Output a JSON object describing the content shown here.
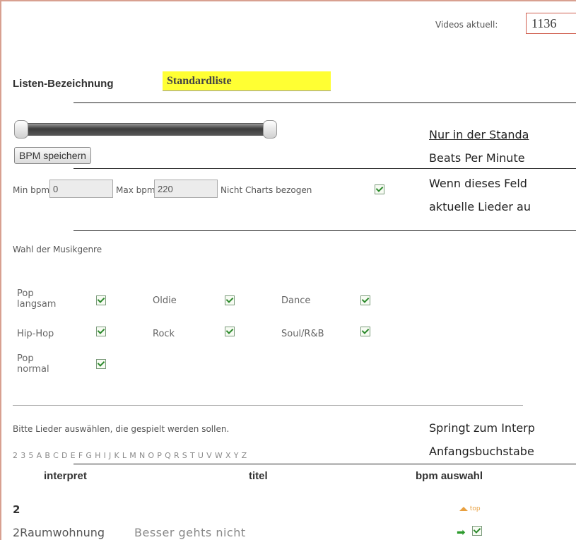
{
  "header": {
    "videos_label": "Videos aktuell:",
    "videos_count": "1136"
  },
  "list": {
    "label": "Listen-Bezeichnung",
    "value": "Standardliste"
  },
  "bpm": {
    "save_button": "BPM speichern",
    "note_line1": "Nur in der Standa",
    "note_line2": "Beats Per Minute",
    "min_label": "Min bpm:",
    "min_value": "0",
    "max_label": "Max bpm:",
    "max_value": "220",
    "charts_label": "Nicht Charts bezogen",
    "charts_note_line1": "Wenn dieses Feld",
    "charts_note_line2": "aktuelle Lieder au"
  },
  "genres": {
    "heading": "Wahl der Musikgenre",
    "items": [
      {
        "name": "Pop langsam",
        "checked": true
      },
      {
        "name": "Oldie",
        "checked": true
      },
      {
        "name": "Dance",
        "checked": true
      },
      {
        "name": "Hip-Hop",
        "checked": true
      },
      {
        "name": "Rock",
        "checked": true
      },
      {
        "name": "Soul/R&B",
        "checked": true
      },
      {
        "name": "Pop normal",
        "checked": true
      }
    ]
  },
  "songs": {
    "instruction": "Bitte Lieder auswählen, die gespielt werden sollen.",
    "jump_note_line1": "Springt zum Interp",
    "jump_note_line2": "Anfangsbuchstabe",
    "letters": [
      "2",
      "3",
      "5",
      "A",
      "B",
      "C",
      "D",
      "E",
      "F",
      "G",
      "H",
      "I",
      "J",
      "K",
      "L",
      "M",
      "N",
      "O",
      "P",
      "Q",
      "R",
      "S",
      "T",
      "U",
      "V",
      "W",
      "X",
      "Y",
      "Z"
    ],
    "columns": {
      "interpret": "interpret",
      "titel": "titel",
      "bpm": "bpm auswahl"
    },
    "group": "2",
    "top_link": "top",
    "rows": [
      {
        "interpret": "2Raumwohnung",
        "titel": "Besser gehts nicht",
        "selected": true
      }
    ]
  }
}
